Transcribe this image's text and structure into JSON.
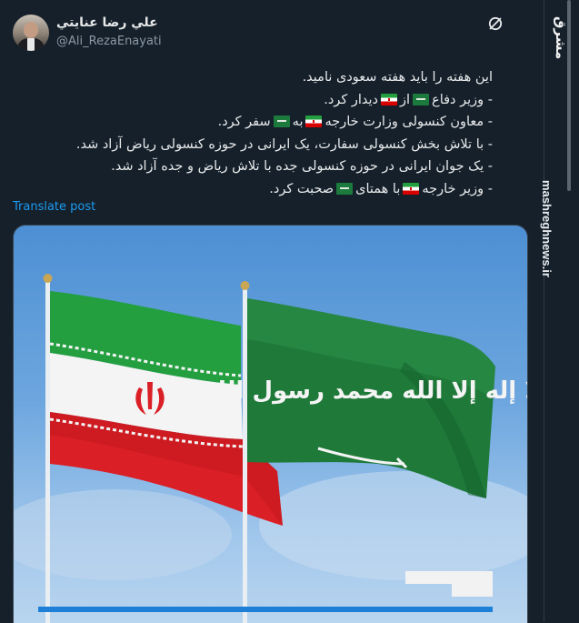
{
  "author": {
    "display_name": "علي رضا عنايتي",
    "handle": "@Ali_RezaEnayati"
  },
  "post": {
    "lines": [
      {
        "segments": [
          {
            "t": "text",
            "v": "این هفته را باید هفته سعودی نامید."
          }
        ]
      },
      {
        "segments": [
          {
            "t": "text",
            "v": "- وزیر دفاع"
          },
          {
            "t": "flag",
            "v": "saudi-flag"
          },
          {
            "t": "text",
            "v": "از"
          },
          {
            "t": "flag",
            "v": "iran-flag"
          },
          {
            "t": "text",
            "v": "دیدار کرد."
          }
        ]
      },
      {
        "segments": [
          {
            "t": "text",
            "v": "- معاون کنسولی وزارت خارجه"
          },
          {
            "t": "flag",
            "v": "iran-flag"
          },
          {
            "t": "text",
            "v": "به"
          },
          {
            "t": "flag",
            "v": "saudi-flag"
          },
          {
            "t": "text",
            "v": "سفر کرد."
          }
        ]
      },
      {
        "segments": [
          {
            "t": "text",
            "v": "- با تلاش بخش کنسولی سفارت، یک ایرانی در حوزه کنسولی ریاض آزاد شد."
          }
        ]
      },
      {
        "segments": [
          {
            "t": "text",
            "v": "- یک جوان ایرانی در حوزه کنسولی جده با تلاش ریاض و جده آزاد شد."
          }
        ]
      },
      {
        "segments": [
          {
            "t": "text",
            "v": "- وزیر خارجه"
          },
          {
            "t": "flag",
            "v": "iran-flag"
          },
          {
            "t": "text",
            "v": "با همتای"
          },
          {
            "t": "flag",
            "v": "saudi-flag"
          },
          {
            "t": "text",
            "v": "صحبت کرد."
          }
        ]
      }
    ],
    "translate_label": "Translate post"
  },
  "media": {
    "description_icons": [
      "iran-flag",
      "saudi-flag"
    ],
    "saudi_flag_inscription": "لا إله إلا الله محمد رسول الله"
  },
  "watermark": {
    "logo": "مشرق",
    "site": "mashreghnews.ir"
  },
  "colors": {
    "background": "#15202b",
    "link": "#1d9bf0",
    "text": "#e7e9ea",
    "muted": "#8b98a5"
  }
}
